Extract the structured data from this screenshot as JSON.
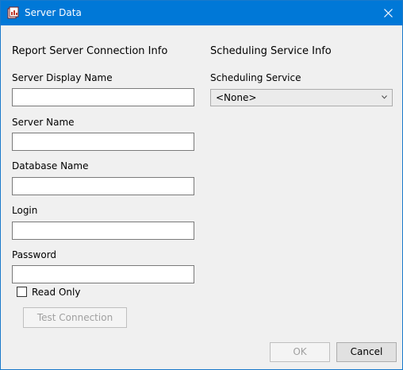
{
  "window": {
    "title": "Server Data"
  },
  "connection": {
    "heading": "Report Server Connection Info",
    "fields": [
      {
        "label": "Server Display Name",
        "value": ""
      },
      {
        "label": "Server Name",
        "value": ""
      },
      {
        "label": "Database Name",
        "value": ""
      },
      {
        "label": "Login",
        "value": ""
      },
      {
        "label": "Password",
        "value": ""
      }
    ],
    "read_only_label": "Read Only",
    "read_only_checked": false,
    "test_button": "Test Connection"
  },
  "scheduling": {
    "heading": "Scheduling Service Info",
    "label": "Scheduling Service",
    "selected": "<None>"
  },
  "footer": {
    "ok_label": "OK",
    "cancel_label": "Cancel"
  },
  "icons": {
    "app": "server-data-icon",
    "close": "close-icon",
    "dropdown": "chevron-down-icon"
  },
  "colors": {
    "titlebar": "#0078d7",
    "dialog_bg": "#f0f0f0"
  }
}
